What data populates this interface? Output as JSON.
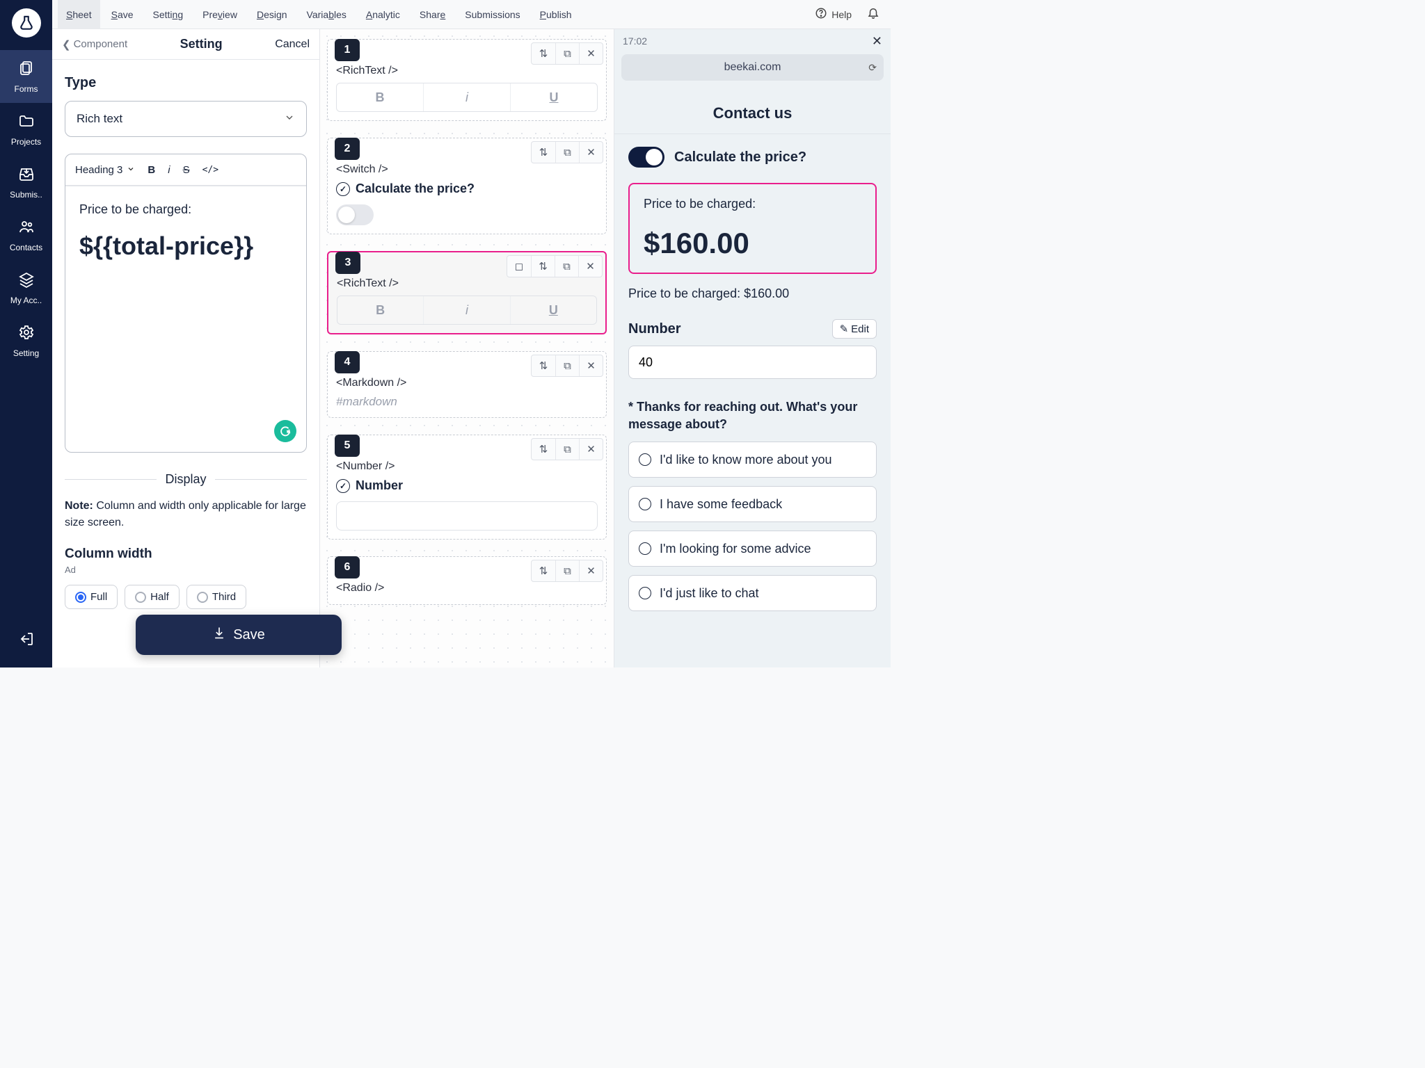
{
  "menubar": {
    "items": [
      "Sheet",
      "Save",
      "Setting",
      "Preview",
      "Design",
      "Variables",
      "Analytic",
      "Share",
      "Submissions",
      "Publish"
    ],
    "help": "Help"
  },
  "sidebar": {
    "items": [
      {
        "label": "Forms",
        "icon": "📋"
      },
      {
        "label": "Projects",
        "icon": "📁"
      },
      {
        "label": "Submis..",
        "icon": "📥"
      },
      {
        "label": "Contacts",
        "icon": "👥"
      },
      {
        "label": "My Acc..",
        "icon": "🗂"
      },
      {
        "label": "Setting",
        "icon": "⚙"
      }
    ],
    "logout_icon": "⎋"
  },
  "settings": {
    "back": "Component",
    "title": "Setting",
    "cancel": "Cancel",
    "type_label": "Type",
    "type_value": "Rich text",
    "editor_toolbar": {
      "heading": "Heading 3",
      "bold": "B",
      "italic": "i",
      "strike": "S",
      "code": "</>"
    },
    "editor_line1": "Price to be charged:",
    "editor_line2": "${{total-price}}",
    "g_badge": "G",
    "display_divider": "Display",
    "note_bold": "Note:",
    "note_text": " Column and width only applicable for large size screen.",
    "colwidth_label": "Column width",
    "colwidth_sub": "Ad",
    "radios": [
      "Full",
      "Half",
      "Third"
    ],
    "save": "Save"
  },
  "canvas": {
    "cards": [
      {
        "num": "1",
        "name": "<RichText />",
        "kind": "biu"
      },
      {
        "num": "2",
        "name": "<Switch />",
        "kind": "switch",
        "label": "Calculate the price?"
      },
      {
        "num": "3",
        "name": "<RichText />",
        "kind": "biu",
        "selected": true,
        "extra": true
      },
      {
        "num": "4",
        "name": "<Markdown />",
        "kind": "markdown",
        "ph": "#markdown"
      },
      {
        "num": "5",
        "name": "<Number />",
        "kind": "number",
        "label": "Number"
      },
      {
        "num": "6",
        "name": "<Radio />",
        "kind": "radio"
      }
    ]
  },
  "preview": {
    "time": "17:02",
    "url": "beekai.com",
    "title": "Contact us",
    "calc_label": "Calculate the price?",
    "price_label": "Price to be charged:",
    "price_value": "$160.00",
    "price_sub": "Price to be charged: $160.00",
    "number_label": "Number",
    "edit": "Edit",
    "number_value": "40",
    "question": "* Thanks for reaching out. What's your message about?",
    "options": [
      "I'd like to know more about you",
      "I have some feedback",
      "I'm looking for some advice",
      "I'd just like to chat"
    ]
  }
}
